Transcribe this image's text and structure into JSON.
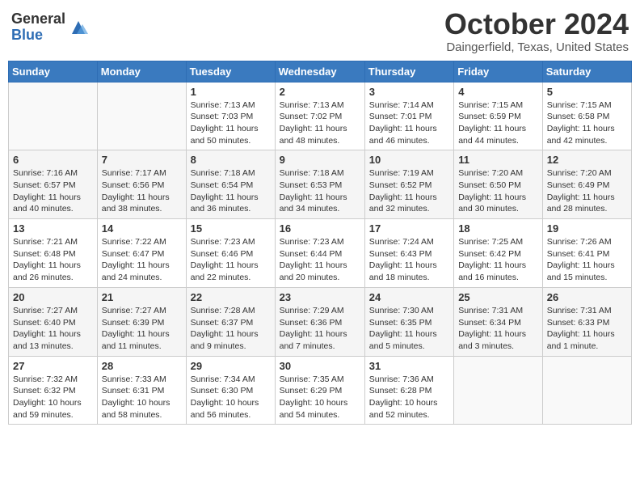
{
  "logo": {
    "general": "General",
    "blue": "Blue"
  },
  "title": "October 2024",
  "location": "Daingerfield, Texas, United States",
  "days_of_week": [
    "Sunday",
    "Monday",
    "Tuesday",
    "Wednesday",
    "Thursday",
    "Friday",
    "Saturday"
  ],
  "weeks": [
    [
      {
        "num": "",
        "sunrise": "",
        "sunset": "",
        "daylight": ""
      },
      {
        "num": "",
        "sunrise": "",
        "sunset": "",
        "daylight": ""
      },
      {
        "num": "1",
        "sunrise": "Sunrise: 7:13 AM",
        "sunset": "Sunset: 7:03 PM",
        "daylight": "Daylight: 11 hours and 50 minutes."
      },
      {
        "num": "2",
        "sunrise": "Sunrise: 7:13 AM",
        "sunset": "Sunset: 7:02 PM",
        "daylight": "Daylight: 11 hours and 48 minutes."
      },
      {
        "num": "3",
        "sunrise": "Sunrise: 7:14 AM",
        "sunset": "Sunset: 7:01 PM",
        "daylight": "Daylight: 11 hours and 46 minutes."
      },
      {
        "num": "4",
        "sunrise": "Sunrise: 7:15 AM",
        "sunset": "Sunset: 6:59 PM",
        "daylight": "Daylight: 11 hours and 44 minutes."
      },
      {
        "num": "5",
        "sunrise": "Sunrise: 7:15 AM",
        "sunset": "Sunset: 6:58 PM",
        "daylight": "Daylight: 11 hours and 42 minutes."
      }
    ],
    [
      {
        "num": "6",
        "sunrise": "Sunrise: 7:16 AM",
        "sunset": "Sunset: 6:57 PM",
        "daylight": "Daylight: 11 hours and 40 minutes."
      },
      {
        "num": "7",
        "sunrise": "Sunrise: 7:17 AM",
        "sunset": "Sunset: 6:56 PM",
        "daylight": "Daylight: 11 hours and 38 minutes."
      },
      {
        "num": "8",
        "sunrise": "Sunrise: 7:18 AM",
        "sunset": "Sunset: 6:54 PM",
        "daylight": "Daylight: 11 hours and 36 minutes."
      },
      {
        "num": "9",
        "sunrise": "Sunrise: 7:18 AM",
        "sunset": "Sunset: 6:53 PM",
        "daylight": "Daylight: 11 hours and 34 minutes."
      },
      {
        "num": "10",
        "sunrise": "Sunrise: 7:19 AM",
        "sunset": "Sunset: 6:52 PM",
        "daylight": "Daylight: 11 hours and 32 minutes."
      },
      {
        "num": "11",
        "sunrise": "Sunrise: 7:20 AM",
        "sunset": "Sunset: 6:50 PM",
        "daylight": "Daylight: 11 hours and 30 minutes."
      },
      {
        "num": "12",
        "sunrise": "Sunrise: 7:20 AM",
        "sunset": "Sunset: 6:49 PM",
        "daylight": "Daylight: 11 hours and 28 minutes."
      }
    ],
    [
      {
        "num": "13",
        "sunrise": "Sunrise: 7:21 AM",
        "sunset": "Sunset: 6:48 PM",
        "daylight": "Daylight: 11 hours and 26 minutes."
      },
      {
        "num": "14",
        "sunrise": "Sunrise: 7:22 AM",
        "sunset": "Sunset: 6:47 PM",
        "daylight": "Daylight: 11 hours and 24 minutes."
      },
      {
        "num": "15",
        "sunrise": "Sunrise: 7:23 AM",
        "sunset": "Sunset: 6:46 PM",
        "daylight": "Daylight: 11 hours and 22 minutes."
      },
      {
        "num": "16",
        "sunrise": "Sunrise: 7:23 AM",
        "sunset": "Sunset: 6:44 PM",
        "daylight": "Daylight: 11 hours and 20 minutes."
      },
      {
        "num": "17",
        "sunrise": "Sunrise: 7:24 AM",
        "sunset": "Sunset: 6:43 PM",
        "daylight": "Daylight: 11 hours and 18 minutes."
      },
      {
        "num": "18",
        "sunrise": "Sunrise: 7:25 AM",
        "sunset": "Sunset: 6:42 PM",
        "daylight": "Daylight: 11 hours and 16 minutes."
      },
      {
        "num": "19",
        "sunrise": "Sunrise: 7:26 AM",
        "sunset": "Sunset: 6:41 PM",
        "daylight": "Daylight: 11 hours and 15 minutes."
      }
    ],
    [
      {
        "num": "20",
        "sunrise": "Sunrise: 7:27 AM",
        "sunset": "Sunset: 6:40 PM",
        "daylight": "Daylight: 11 hours and 13 minutes."
      },
      {
        "num": "21",
        "sunrise": "Sunrise: 7:27 AM",
        "sunset": "Sunset: 6:39 PM",
        "daylight": "Daylight: 11 hours and 11 minutes."
      },
      {
        "num": "22",
        "sunrise": "Sunrise: 7:28 AM",
        "sunset": "Sunset: 6:37 PM",
        "daylight": "Daylight: 11 hours and 9 minutes."
      },
      {
        "num": "23",
        "sunrise": "Sunrise: 7:29 AM",
        "sunset": "Sunset: 6:36 PM",
        "daylight": "Daylight: 11 hours and 7 minutes."
      },
      {
        "num": "24",
        "sunrise": "Sunrise: 7:30 AM",
        "sunset": "Sunset: 6:35 PM",
        "daylight": "Daylight: 11 hours and 5 minutes."
      },
      {
        "num": "25",
        "sunrise": "Sunrise: 7:31 AM",
        "sunset": "Sunset: 6:34 PM",
        "daylight": "Daylight: 11 hours and 3 minutes."
      },
      {
        "num": "26",
        "sunrise": "Sunrise: 7:31 AM",
        "sunset": "Sunset: 6:33 PM",
        "daylight": "Daylight: 11 hours and 1 minute."
      }
    ],
    [
      {
        "num": "27",
        "sunrise": "Sunrise: 7:32 AM",
        "sunset": "Sunset: 6:32 PM",
        "daylight": "Daylight: 10 hours and 59 minutes."
      },
      {
        "num": "28",
        "sunrise": "Sunrise: 7:33 AM",
        "sunset": "Sunset: 6:31 PM",
        "daylight": "Daylight: 10 hours and 58 minutes."
      },
      {
        "num": "29",
        "sunrise": "Sunrise: 7:34 AM",
        "sunset": "Sunset: 6:30 PM",
        "daylight": "Daylight: 10 hours and 56 minutes."
      },
      {
        "num": "30",
        "sunrise": "Sunrise: 7:35 AM",
        "sunset": "Sunset: 6:29 PM",
        "daylight": "Daylight: 10 hours and 54 minutes."
      },
      {
        "num": "31",
        "sunrise": "Sunrise: 7:36 AM",
        "sunset": "Sunset: 6:28 PM",
        "daylight": "Daylight: 10 hours and 52 minutes."
      },
      {
        "num": "",
        "sunrise": "",
        "sunset": "",
        "daylight": ""
      },
      {
        "num": "",
        "sunrise": "",
        "sunset": "",
        "daylight": ""
      }
    ]
  ]
}
